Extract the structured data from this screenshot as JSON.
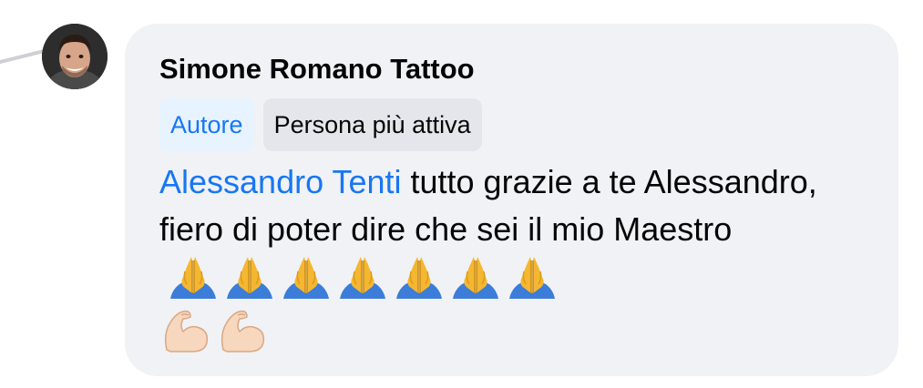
{
  "comment": {
    "author": "Simone Romano Tattoo",
    "badges": {
      "author": "Autore",
      "top_fan": "Persona più attiva"
    },
    "mention": "Alessandro Tenti",
    "text_part1": " tutto grazie a te Alessandro,  fiero di poter dire che sei il mio Maestro",
    "emojis_line1": [
      "folded-hands-icon",
      "folded-hands-icon",
      "folded-hands-icon",
      "folded-hands-icon",
      "folded-hands-icon",
      "folded-hands-icon",
      "folded-hands-icon"
    ],
    "emojis_line2": [
      "flexed-biceps-icon",
      "flexed-biceps-icon"
    ]
  },
  "colors": {
    "bubble_bg": "#f0f2f5",
    "mention": "#1877f2",
    "author_badge_bg": "#e7f3ff",
    "active_badge_bg": "#e4e6eb"
  }
}
